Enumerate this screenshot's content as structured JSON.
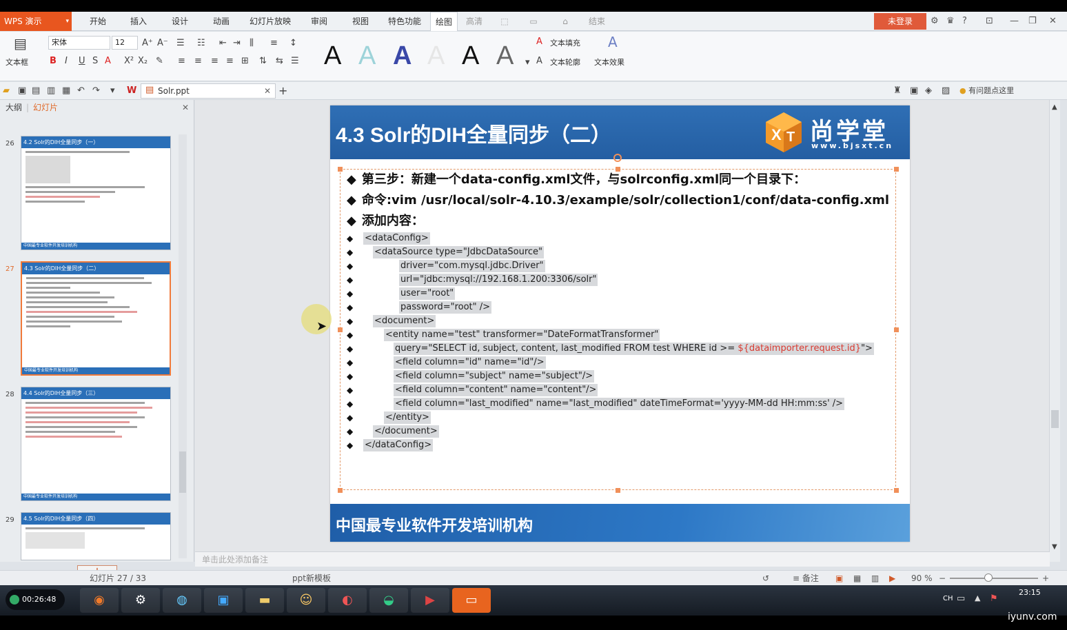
{
  "app": {
    "brand": "WPS 演示"
  },
  "menu": {
    "items": [
      "开始",
      "插入",
      "设计",
      "动画",
      "幻灯片放映",
      "审阅",
      "视图",
      "特色功能",
      "绘图",
      "高清"
    ],
    "extra": "结束",
    "login": "未登录",
    "help": "?"
  },
  "ribbon": {
    "textbox_label": "文本框",
    "font_name": "宋体",
    "font_size": "12",
    "bold": "B",
    "italic": "I",
    "underline": "U",
    "strike": "S",
    "text_fill": "文本填充",
    "text_outline": "文本轮廓",
    "text_effect": "文本效果",
    "style_letter": "A"
  },
  "quickbar": {
    "doc_tab": "Solr.ppt",
    "help_link": "有问题点这里"
  },
  "leftpanel": {
    "tab_outline": "大纲",
    "tab_slides": "幻灯片",
    "thumbs": [
      {
        "num": "26",
        "title": "4.2 Solr的DIH全量同步（一）"
      },
      {
        "num": "27",
        "title": "4.3 Solr的DIH全量同步（二）"
      },
      {
        "num": "28",
        "title": "4.4 Solr的DIH全量同步（三）"
      },
      {
        "num": "29",
        "title": "4.5 Solr的DIH全量同步（四）"
      }
    ],
    "thumb_footer": "中国最专业软件开发培训机构",
    "add": "+"
  },
  "slide": {
    "title": "4.3 Solr的DIH全量同步（二）",
    "logo_text": "尚学堂",
    "logo_url": "www.bjsxt.cn",
    "bullets": [
      "第三步：新建一个data-config.xml文件，与solrconfig.xml同一个目录下：",
      "命令:vim /usr/local/solr-4.10.3/example/solr/collection1/conf/data-config.xml",
      "添加内容："
    ],
    "code": [
      "<dataConfig>",
      "<dataSource type=\"JdbcDataSource\"",
      "driver=\"com.mysql.jdbc.Driver\"",
      "url=\"jdbc:mysql://192.168.1.200:3306/solr\"",
      "user=\"root\"",
      "password=\"root\" />",
      "<document>",
      "<entity name=\"test\" transformer=\"DateFormatTransformer\"",
      "query=\"SELECT id, subject, content, last_modified FROM test WHERE id >= ",
      "<field column=\"id\" name=\"id\"/>",
      "<field column=\"subject\" name=\"subject\"/>",
      "<field column=\"content\" name=\"content\"/>",
      "<field column=\"last_modified\" name=\"last_modified\" dateTimeFormat='yyyy-MM-dd HH:mm:ss' />",
      "</entity>",
      "</document>",
      "</dataConfig>"
    ],
    "code_highlight": "${dataimporter.request.id}",
    "code_tail": "\">",
    "footer": "中国最专业软件开发培训机构",
    "bullet_glyph": "◆"
  },
  "notes": {
    "placeholder": "单击此处添加备注"
  },
  "status": {
    "slide_count": "幻灯片 27 / 33",
    "template": "ppt新模板",
    "notes_btn": "备注",
    "zoom": "90 %"
  },
  "taskbar": {
    "rec_time": "00:26:48",
    "clock": "23:15",
    "watermark": "iyunv.com"
  }
}
